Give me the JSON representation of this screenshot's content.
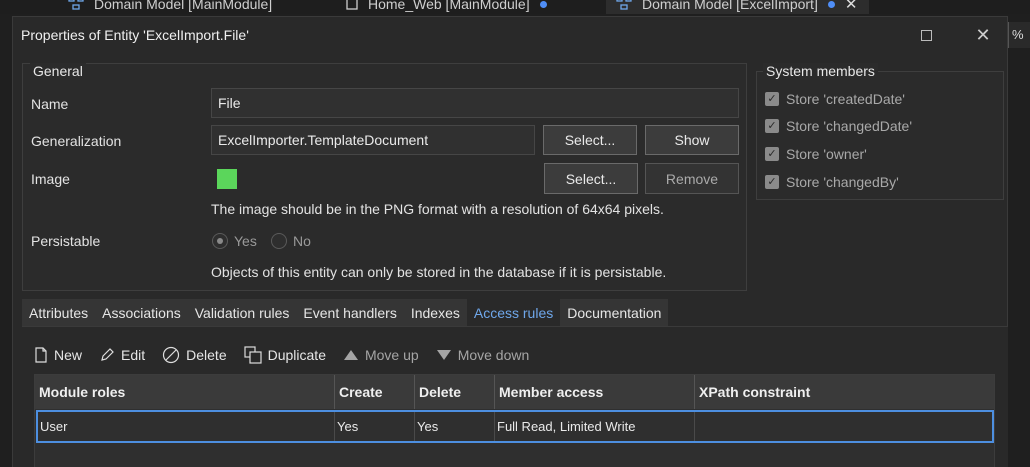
{
  "editor_tabs": [
    {
      "label": "Domain Model [MainModule]",
      "icon": "domain-model-icon",
      "dirty": false
    },
    {
      "label": "Home_Web [MainModule]",
      "icon": "page-icon",
      "dirty": true
    },
    {
      "label": "Domain Model [ExcelImport]",
      "icon": "domain-model-icon",
      "dirty": true
    }
  ],
  "zoom_fragment": "%",
  "dialog": {
    "title": "Properties of Entity 'ExcelImport.File'",
    "general": {
      "title": "General",
      "name_label": "Name",
      "name_value": "File",
      "generalization_label": "Generalization",
      "generalization_value": "ExcelImporter.TemplateDocument",
      "select_label": "Select...",
      "show_label": "Show",
      "image_label": "Image",
      "image_color": "#5bd65b",
      "image_select_label": "Select...",
      "remove_label": "Remove",
      "image_note": "The image should be in the PNG format with a resolution of 64x64 pixels.",
      "persistable_label": "Persistable",
      "yes_label": "Yes",
      "no_label": "No",
      "persistable_value": "Yes",
      "persist_note": "Objects of this entity can only be stored in the database if it is persistable."
    },
    "system_members": {
      "title": "System members",
      "items": [
        {
          "label": "Store 'createdDate'",
          "checked": true
        },
        {
          "label": "Store 'changedDate'",
          "checked": true
        },
        {
          "label": "Store 'owner'",
          "checked": true
        },
        {
          "label": "Store 'changedBy'",
          "checked": true
        }
      ]
    },
    "tabs": [
      "Attributes",
      "Associations",
      "Validation rules",
      "Event handlers",
      "Indexes",
      "Access rules",
      "Documentation"
    ],
    "active_tab": "Access rules",
    "toolbar": {
      "new": "New",
      "edit": "Edit",
      "delete": "Delete",
      "duplicate": "Duplicate",
      "move_up": "Move up",
      "move_down": "Move down"
    },
    "grid": {
      "columns": [
        "Module roles",
        "Create",
        "Delete",
        "Member access",
        "XPath constraint"
      ],
      "rows": [
        [
          "User",
          "Yes",
          "Yes",
          "Full Read, Limited Write",
          ""
        ]
      ]
    }
  }
}
